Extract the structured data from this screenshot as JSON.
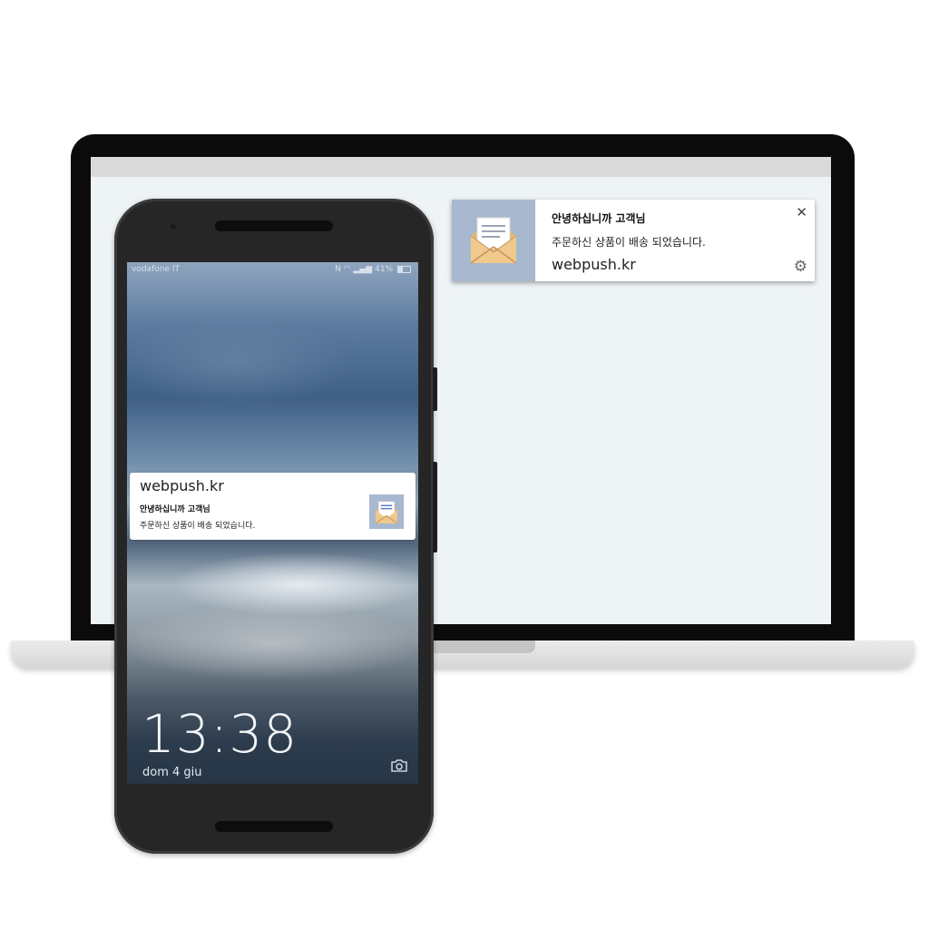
{
  "desktop_notification": {
    "title": "안녕하십니까 고객님",
    "body": "주문하신 상품이 배송 되었습니다.",
    "site": "webpush.kr",
    "close_symbol": "✕",
    "icon": "envelope-icon",
    "settings_icon": "gear-icon"
  },
  "phone": {
    "status_bar": {
      "carrier": "vodafone IT",
      "battery_text": "41%",
      "battery_level": 0.41,
      "icons": [
        "nfc-icon",
        "wifi-icon",
        "signal-icon",
        "battery-icon"
      ]
    },
    "notification": {
      "site": "webpush.kr",
      "title": "안녕하십니까 고객님",
      "body": "주문하신 상품이 배송 되었습니다.",
      "icon": "envelope-icon"
    },
    "lockscreen": {
      "time": "13:38",
      "date": "dom 4 giu",
      "camera_icon": "camera-icon"
    }
  },
  "colors": {
    "icon_background": "#a8b8ce",
    "laptop_bezel": "#0b0b0b",
    "phone_body": "#262626"
  }
}
